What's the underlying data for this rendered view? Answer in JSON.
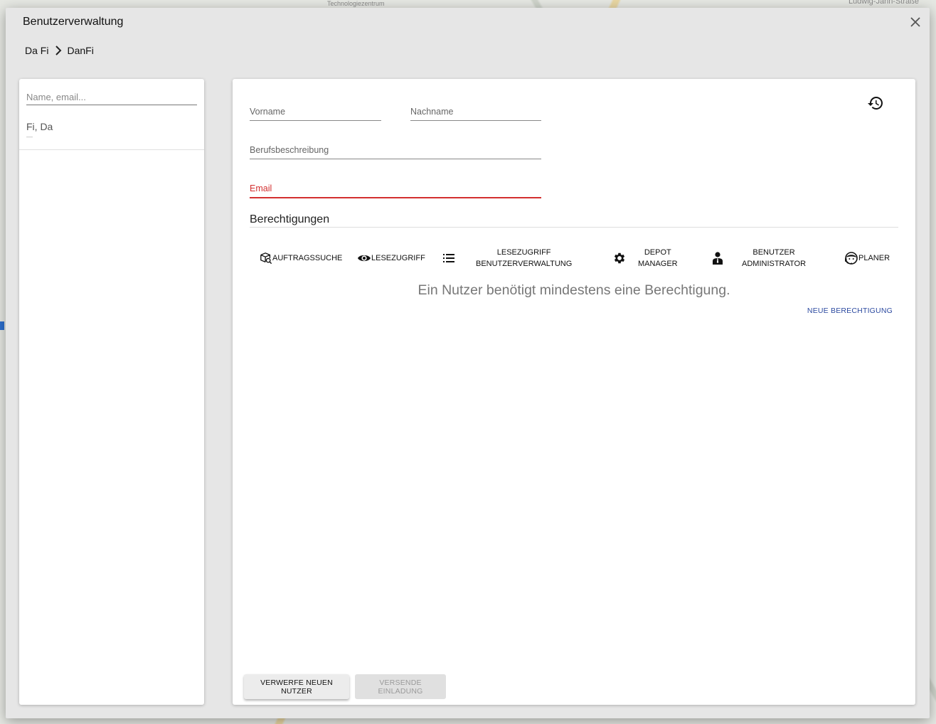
{
  "background": {
    "map_label_top": "Technologiezentrum",
    "map_label_right": "Ludwig-Jahn-Straße"
  },
  "dialog": {
    "title": "Benutzerverwaltung",
    "close_icon": "close-icon"
  },
  "breadcrumb": {
    "items": [
      "Da Fi",
      "DanFi"
    ],
    "separator_icon": "chevron-right-icon"
  },
  "sidebar": {
    "search_placeholder": "Name, email...",
    "users": [
      {
        "name": "Fi, Da",
        "subtitle": "—"
      }
    ]
  },
  "form": {
    "history_icon": "history-icon",
    "firstname_label": "Vorname",
    "lastname_label": "Nachname",
    "job_label": "Berufsbeschreibung",
    "email_label": "Email",
    "email_error": true,
    "error_color": "#d32f2f"
  },
  "permissions": {
    "title": "Berechtigungen",
    "items": [
      {
        "label": "AUFTRAGSSUCHE",
        "icon": "package-search-icon"
      },
      {
        "label": "LESEZUGRIFF",
        "icon": "eye-icon"
      },
      {
        "label": "LESEZUGRIFF\nBENUTZERVERWALTUNG",
        "icon": "list-icon"
      },
      {
        "label": "DEPOT\nMANAGER",
        "icon": "gear-icon"
      },
      {
        "label": "BENUTZER\nADMINISTRATOR",
        "icon": "user-tie-icon"
      },
      {
        "label": "PLANER",
        "icon": "headset-icon"
      }
    ],
    "empty_message": "Ein Nutzer benötigt mindestens eine Berechtigung.",
    "new_permission_label": "NEUE BERECHTIGUNG",
    "link_color": "#2c4aa0"
  },
  "actions": {
    "discard_label": "VERWERFE NEUEN NUTZER",
    "send_label": "VERSENDE EINLADUNG"
  }
}
